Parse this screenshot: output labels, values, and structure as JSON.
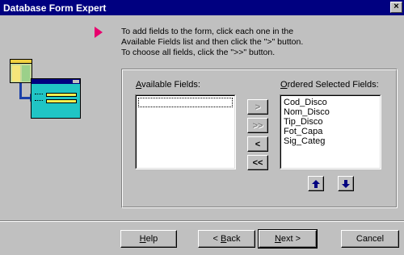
{
  "window": {
    "title": "Database Form Expert",
    "close_label": "×"
  },
  "instructions": {
    "line1": "To add fields to the form, click each one in the",
    "line2": "Available Fields list and then click the \">\" button.",
    "line3": "To choose all fields, click the \">>\" button."
  },
  "available": {
    "label_accel": "A",
    "label_rest": "vailable Fields:",
    "items": []
  },
  "selected": {
    "label_accel": "O",
    "label_rest": "rdered Selected Fields:",
    "items": [
      "Cod_Disco",
      "Nom_Disco",
      "Tip_Disco",
      "Fot_Capa",
      "Sig_Categ"
    ]
  },
  "transfer_buttons": {
    "add_one": ">",
    "add_all": ">>",
    "remove_one": "<",
    "remove_all": "<<"
  },
  "order_buttons": {
    "up_icon": "arrow-up-icon",
    "down_icon": "arrow-down-icon"
  },
  "footer": {
    "help_accel": "H",
    "help_rest": "elp",
    "back_prefix": "< ",
    "back_accel": "B",
    "back_rest": "ack",
    "next_accel": "N",
    "next_rest": "ext >",
    "cancel": "Cancel"
  },
  "colors": {
    "titlebar": "#000080",
    "face": "#c0c0c0",
    "pointer": "#e8006e",
    "form_preview": "#20c5c5"
  }
}
